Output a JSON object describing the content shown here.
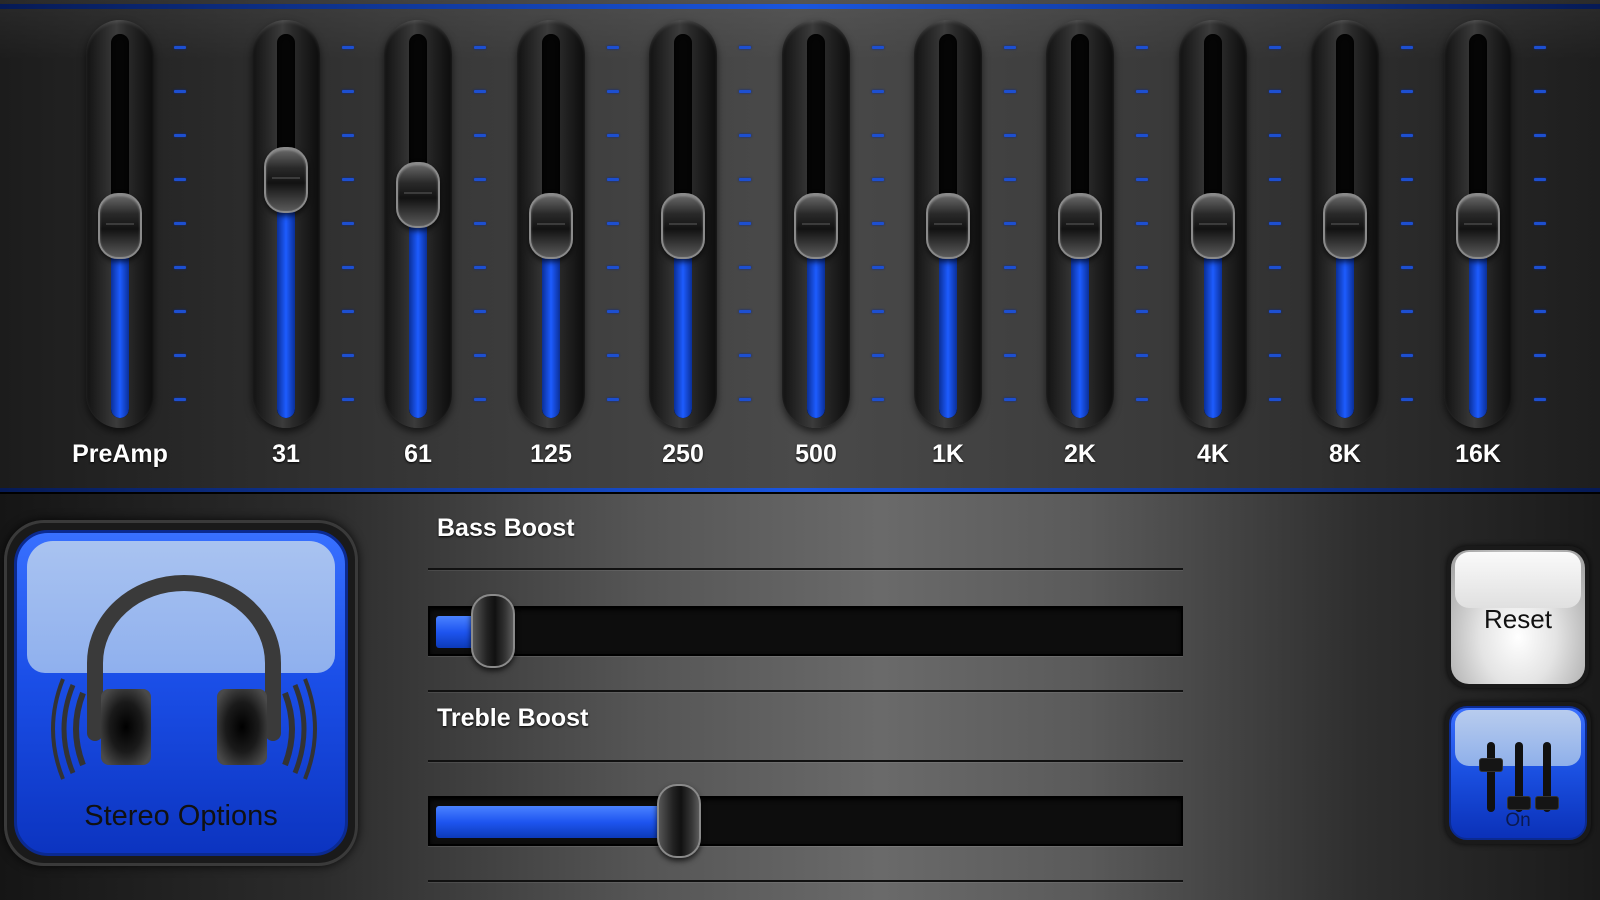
{
  "equalizer": {
    "bands": [
      {
        "label": "PreAmp",
        "level": 0.5
      },
      {
        "label": "31",
        "level": 0.62
      },
      {
        "label": "61",
        "level": 0.58
      },
      {
        "label": "125",
        "level": 0.5
      },
      {
        "label": "250",
        "level": 0.5
      },
      {
        "label": "500",
        "level": 0.5
      },
      {
        "label": "1K",
        "level": 0.5
      },
      {
        "label": "2K",
        "level": 0.5
      },
      {
        "label": "4K",
        "level": 0.5
      },
      {
        "label": "8K",
        "level": 0.5
      },
      {
        "label": "16K",
        "level": 0.5
      }
    ]
  },
  "stereo_options": {
    "label": "Stereo Options"
  },
  "bass_boost": {
    "label": "Bass Boost",
    "level": 0.08
  },
  "treble_boost": {
    "label": "Treble Boost",
    "level": 0.33
  },
  "reset": {
    "label": "Reset"
  },
  "power": {
    "label": "On"
  },
  "colors": {
    "accent": "#1d5cff",
    "background": "#000000"
  }
}
